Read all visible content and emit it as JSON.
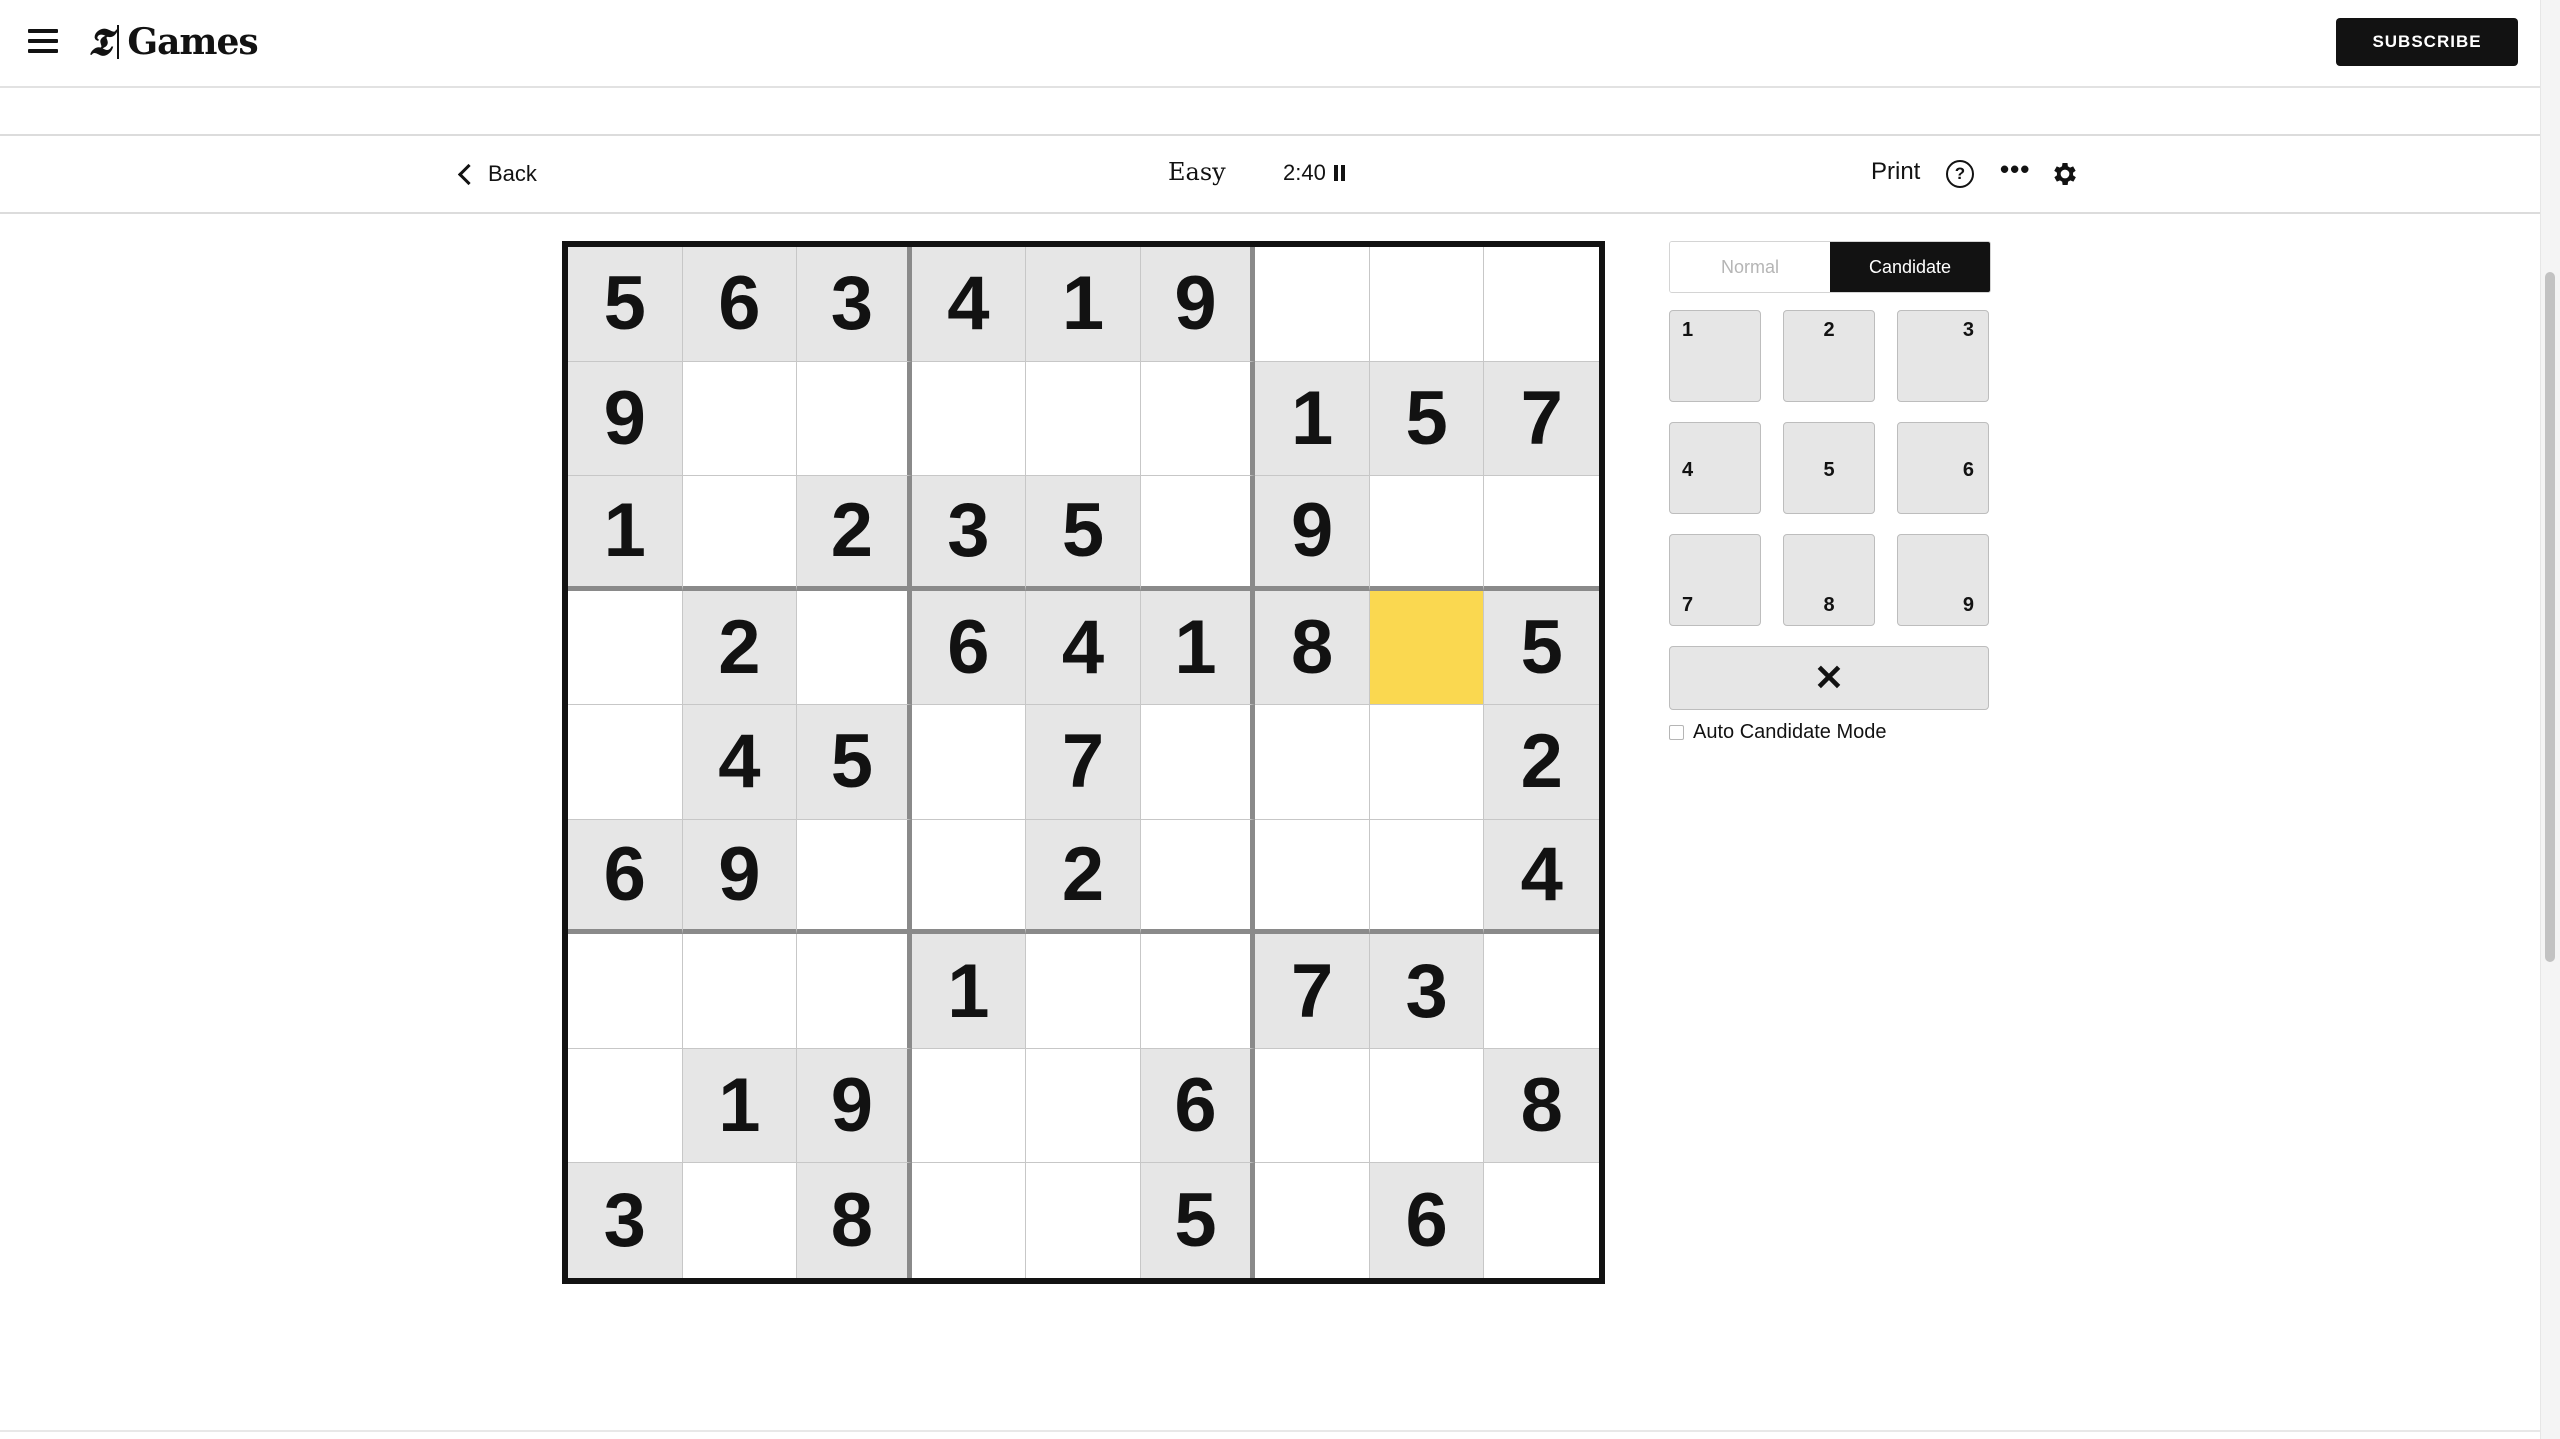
{
  "header": {
    "logo_mark": "𝕿",
    "logo_text": "Games",
    "subscribe_label": "SUBSCRIBE"
  },
  "toolbar": {
    "back_label": "Back",
    "difficulty": "Easy",
    "timer": "2:40",
    "print_label": "Print",
    "help_label": "?",
    "more_label": "•••"
  },
  "board": {
    "selected_cell": [
      3,
      7
    ],
    "cells": [
      [
        "5",
        "6",
        "3",
        "4",
        "1",
        "9",
        "",
        "",
        ""
      ],
      [
        "9",
        "",
        "",
        "",
        "",
        "",
        "1",
        "5",
        "7"
      ],
      [
        "1",
        "",
        "2",
        "3",
        "5",
        "",
        "9",
        "",
        ""
      ],
      [
        "",
        "2",
        "",
        "6",
        "4",
        "1",
        "8",
        "",
        "5"
      ],
      [
        "",
        "4",
        "5",
        "",
        "7",
        "",
        "",
        "",
        "2"
      ],
      [
        "6",
        "9",
        "",
        "",
        "2",
        "",
        "",
        "",
        "4"
      ],
      [
        "",
        "",
        "",
        "1",
        "",
        "",
        "7",
        "3",
        ""
      ],
      [
        "",
        "1",
        "9",
        "",
        "",
        "6",
        "",
        "",
        "8"
      ],
      [
        "3",
        "",
        "8",
        "",
        "",
        "5",
        "",
        "6",
        ""
      ]
    ]
  },
  "side_panel": {
    "modes": {
      "normal": "Normal",
      "candidate": "Candidate",
      "active": "candidate"
    },
    "keys": [
      "1",
      "2",
      "3",
      "4",
      "5",
      "6",
      "7",
      "8",
      "9"
    ],
    "erase_label": "✕",
    "auto_candidate_label": "Auto Candidate Mode",
    "auto_candidate_checked": false
  },
  "colors": {
    "selected_cell": "#fad850",
    "prefilled_cell": "#e6e6e6",
    "text": "#121212"
  },
  "icons": [
    "hamburger-menu-icon",
    "nyt-logo-icon",
    "chevron-left-icon",
    "pause-icon",
    "help-circle-icon",
    "more-dots-icon",
    "gear-icon",
    "erase-x-icon"
  ]
}
